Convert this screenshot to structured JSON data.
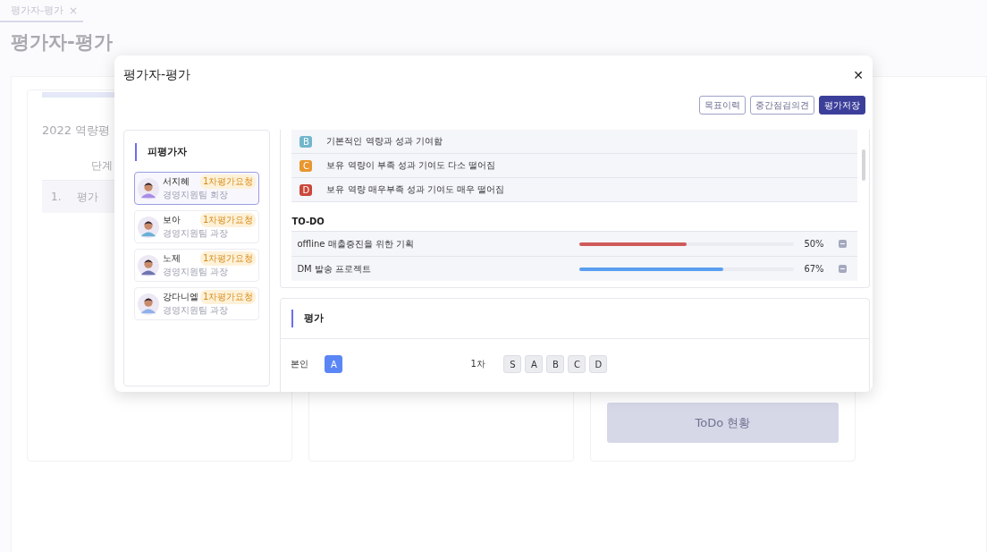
{
  "page_tab": {
    "label": "평가자-평가",
    "close": "×"
  },
  "page_title": "평가자-평가",
  "background": {
    "card_title": "2022 역량평",
    "column_header": "단계",
    "row_number": "1.",
    "row_label": "평가",
    "todo_button": "ToDo 현황"
  },
  "modal": {
    "title": "평가자-평가",
    "close": "✕",
    "buttons": [
      {
        "label": "목표이력",
        "kind": "outline"
      },
      {
        "label": "중간점검의견",
        "kind": "outline"
      },
      {
        "label": "평가저장",
        "kind": "primary"
      }
    ],
    "evaluatees_title": "피평가자",
    "evaluatees": [
      {
        "name": "서지혜",
        "role": "경영지원팀 회장",
        "badge": "1차평가요청",
        "selected": true
      },
      {
        "name": "보아",
        "role": "경영지원팀 과장",
        "badge": "1차평가요청",
        "selected": false
      },
      {
        "name": "노제",
        "role": "경영지원팀 과장",
        "badge": "1차평가요청",
        "selected": false
      },
      {
        "name": "강다니엘",
        "role": "경영지원팀 과장",
        "badge": "1차평가요청",
        "selected": false
      }
    ],
    "grades": [
      {
        "letter": "B",
        "text": "기본적인 역량과 성과 기여함",
        "color": "#72b6cc"
      },
      {
        "letter": "C",
        "text": "보유 역량이 부족 성과 기여도 다소 떨어짐",
        "color": "#e8962e"
      },
      {
        "letter": "D",
        "text": "보유 역량 매우부족 성과 기여도 매우 떨어짐",
        "color": "#c9483a"
      }
    ],
    "todo_title": "TO-DO",
    "todos": [
      {
        "name": "offline 매출증진을 위한 기획",
        "level": 0.5,
        "reading": "50%",
        "color": "#d05a5a"
      },
      {
        "name": "DM 발송 프로젝트",
        "level": 0.67,
        "reading": "67%",
        "color": "#5a9ef0"
      }
    ],
    "evaluation_title": "평가",
    "self_label": "본인",
    "self_grades": [
      {
        "label": "A",
        "selected": true
      }
    ],
    "first_label": "1차",
    "first_grades": [
      {
        "label": "S",
        "selected": false
      },
      {
        "label": "A",
        "selected": false
      },
      {
        "label": "B",
        "selected": false
      },
      {
        "label": "C",
        "selected": false
      },
      {
        "label": "D",
        "selected": false
      }
    ]
  }
}
